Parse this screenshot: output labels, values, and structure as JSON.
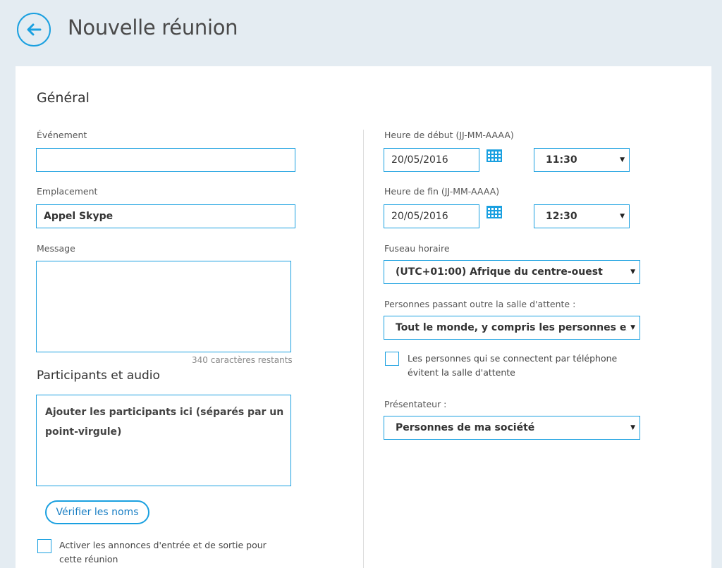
{
  "header": {
    "title": "Nouvelle réunion"
  },
  "general": {
    "title": "Général",
    "event_label": "Événement",
    "event_value": "",
    "location_label": "Emplacement",
    "location_value": "Appel Skype",
    "message_label": "Message",
    "message_value": "",
    "chars_remaining": "340 caractères restants"
  },
  "participants": {
    "title": "Participants et audio",
    "placeholder": "Ajouter les participants ici (séparés par un point-virgule)",
    "verify_button": "Vérifier les noms",
    "announce_label": "Activer les annonces d'entrée et de sortie pour cette réunion"
  },
  "schedule": {
    "start_label": "Heure de début (JJ-MM-AAAA)",
    "start_date": "20/05/2016",
    "start_time": "11:30",
    "end_label": "Heure de fin (JJ-MM-AAAA)",
    "end_date": "20/05/2016",
    "end_time": "12:30",
    "timezone_label": "Fuseau horaire",
    "timezone_value": "(UTC+01:00) Afrique du centre-ouest",
    "lobby_label": "Personnes passant outre la salle d'attente :",
    "lobby_value": "Tout le monde, y compris les personnes extérie",
    "phone_bypass_label": "Les personnes qui se connectent par téléphone évitent la salle d'attente",
    "presenter_label": "Présentateur :",
    "presenter_value": "Personnes de ma société"
  },
  "icons": {
    "back": "arrow-left-icon",
    "calendar": "calendar-icon",
    "caret": "chevron-down-icon"
  },
  "colors": {
    "accent": "#1aa0e0",
    "background": "#e4ecf2",
    "card": "#ffffff"
  }
}
